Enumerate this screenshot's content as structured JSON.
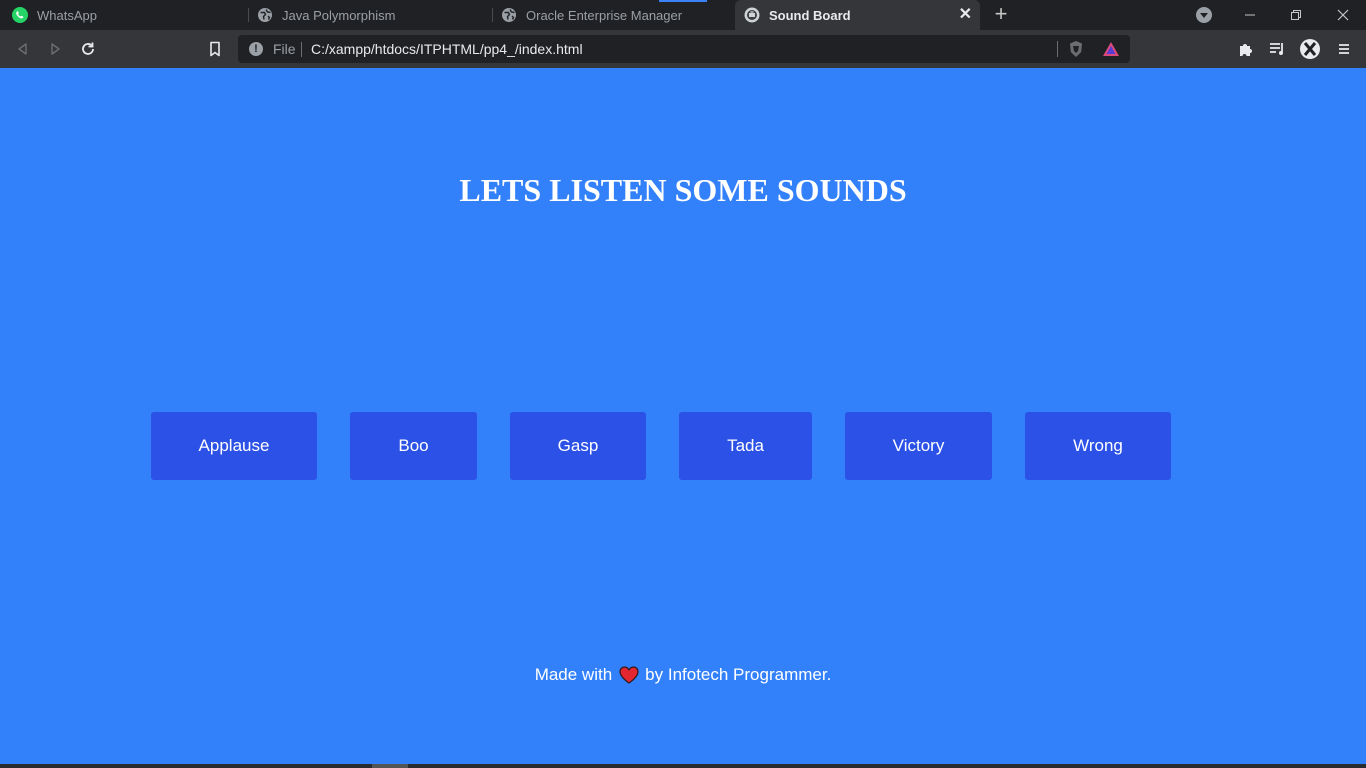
{
  "tabs": [
    {
      "label": "WhatsApp",
      "icon": "whatsapp-icon",
      "active": false
    },
    {
      "label": "Java Polymorphism",
      "icon": "globe-icon",
      "active": false
    },
    {
      "label": "Oracle Enterprise Manager",
      "icon": "globe-icon",
      "active": false
    },
    {
      "label": "Sound Board",
      "icon": "sound-board-favicon",
      "active": true
    }
  ],
  "address_bar": {
    "scheme": "File",
    "url": "C:/xampp/htdocs/ITPHTML/pp4_/index.html"
  },
  "page": {
    "title": "LETS LISTEN SOME SOUNDS",
    "buttons": [
      "Applause",
      "Boo",
      "Gasp",
      "Tada",
      "Victory",
      "Wrong"
    ],
    "footer": {
      "prefix": "Made with",
      "suffix": "by Infotech Programmer."
    }
  },
  "colors": {
    "background": "#3381fa",
    "button": "#2c51e6",
    "heart": "#e3262f"
  }
}
